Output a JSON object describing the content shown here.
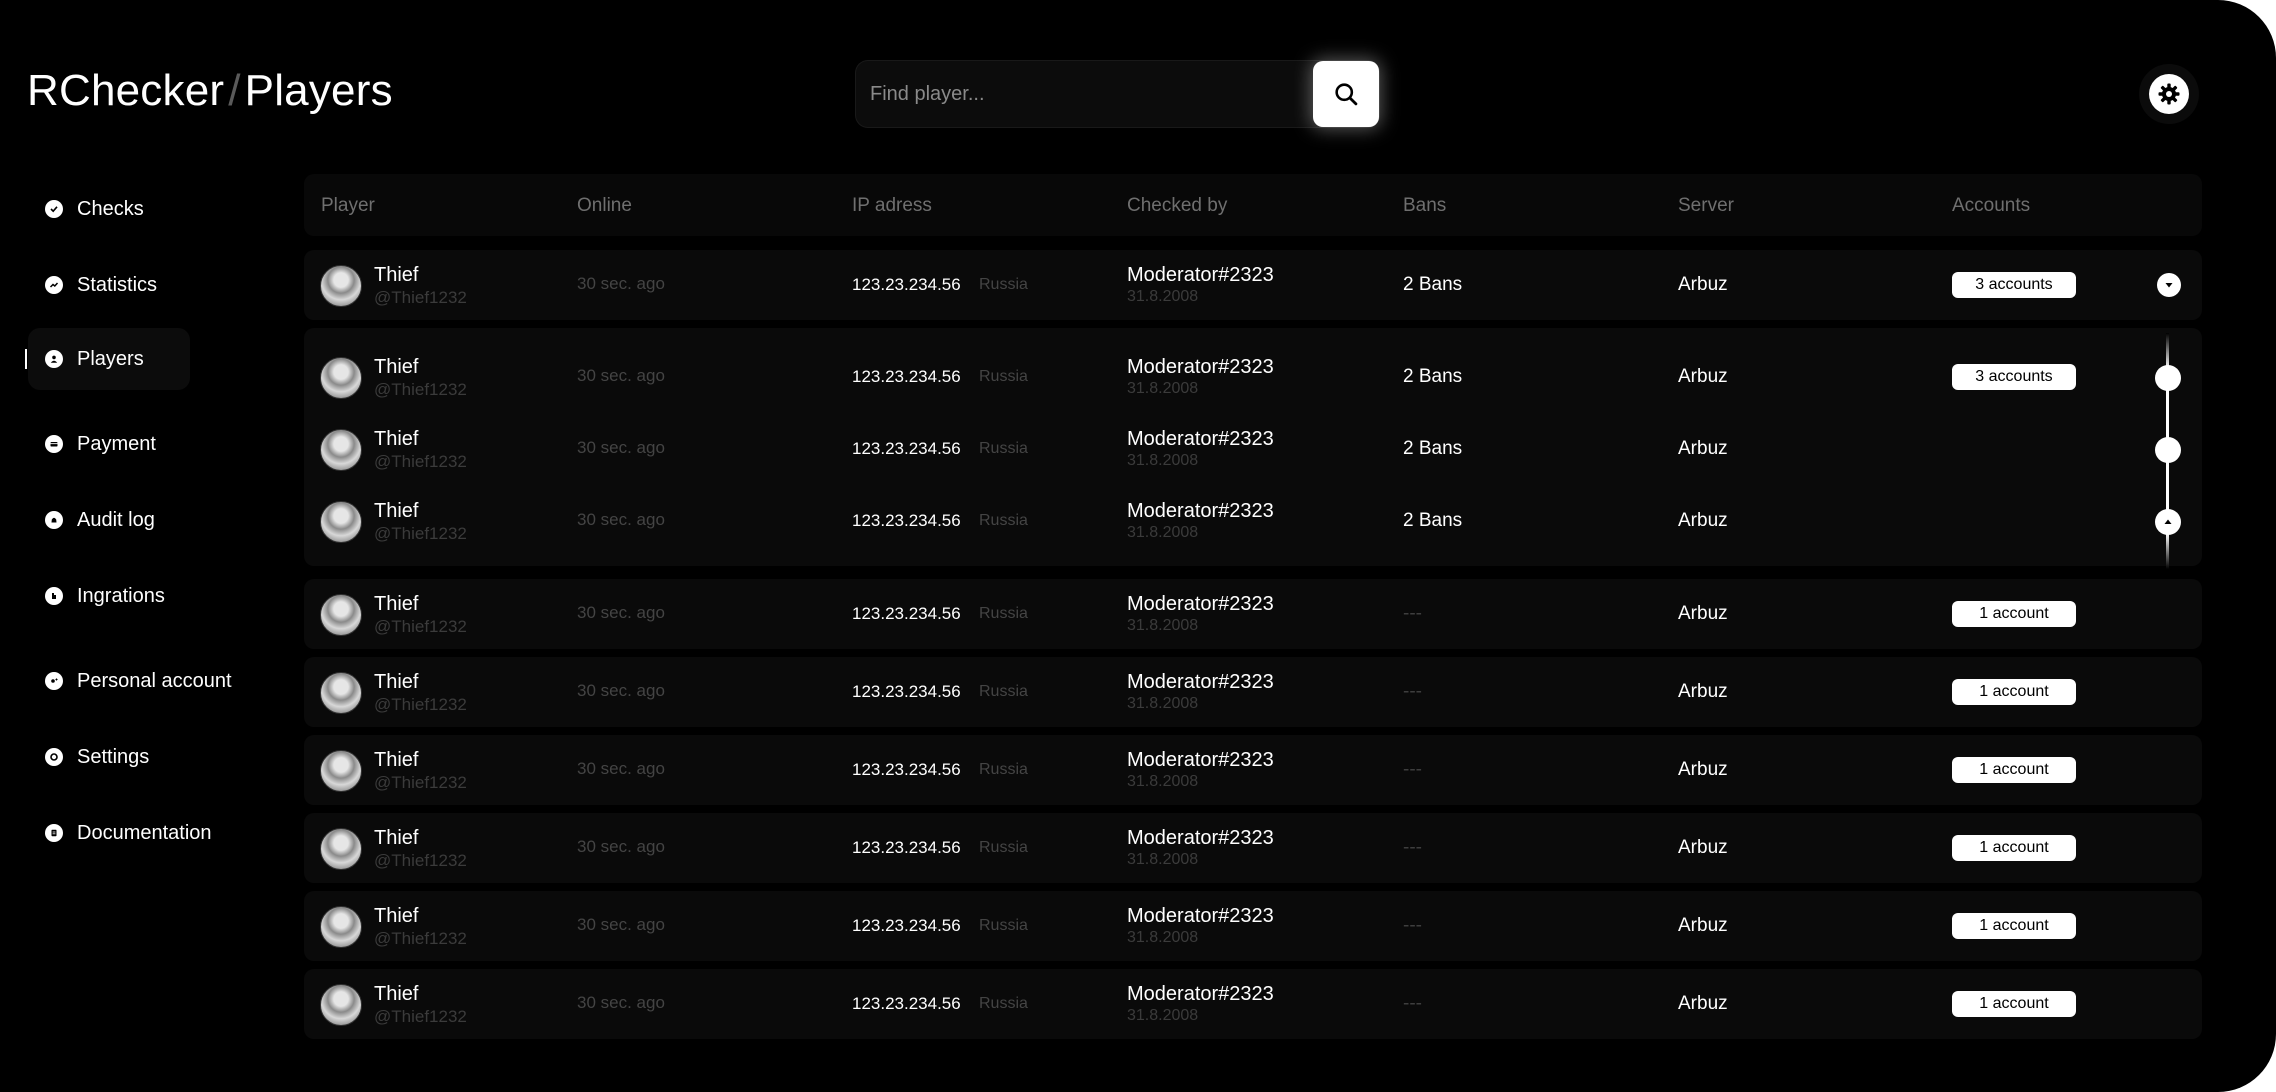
{
  "header": {
    "app_name": "RChecker",
    "separator": "/",
    "page_title": "Players",
    "search_placeholder": "Find player...",
    "search_icon": "search-icon",
    "settings_icon": "gear-icon"
  },
  "sidebar": {
    "items": [
      {
        "label": "Checks",
        "icon": "check-circle-icon"
      },
      {
        "label": "Statistics",
        "icon": "trend-icon"
      },
      {
        "label": "Players",
        "icon": "user-icon",
        "active": true
      },
      {
        "label": "Payment",
        "icon": "card-icon"
      },
      {
        "label": "Audit log",
        "icon": "bell-icon"
      },
      {
        "label": "Ingrations",
        "icon": "puzzle-icon"
      },
      {
        "label": "Personal account",
        "icon": "account-icon"
      },
      {
        "label": "Settings",
        "icon": "gear-icon"
      },
      {
        "label": "Documentation",
        "icon": "doc-icon"
      }
    ]
  },
  "table": {
    "columns": [
      "Player",
      "Online",
      "IP adress",
      "Checked by",
      "Bans",
      "Server",
      "Accounts"
    ],
    "rows": [
      {
        "name": "Thief",
        "handle": "@Thief1232",
        "online": "30 sec. ago",
        "ip": "123.23.234.56",
        "country": "Russia",
        "checked_by": "Moderator#2323",
        "date": "31.8.2008",
        "bans": "2 Bans",
        "server": "Arbuz",
        "accounts": "3 accounts"
      },
      {
        "name": "Thief",
        "handle": "@Thief1232",
        "online": "30 sec. ago",
        "ip": "123.23.234.56",
        "country": "Russia",
        "checked_by": "Moderator#2323",
        "date": "31.8.2008",
        "bans": "2 Bans",
        "server": "Arbuz",
        "accounts": "3 accounts"
      },
      {
        "name": "Thief",
        "handle": "@Thief1232",
        "online": "30 sec. ago",
        "ip": "123.23.234.56",
        "country": "Russia",
        "checked_by": "Moderator#2323",
        "date": "31.8.2008",
        "bans": "2 Bans",
        "server": "Arbuz",
        "accounts": ""
      },
      {
        "name": "Thief",
        "handle": "@Thief1232",
        "online": "30 sec. ago",
        "ip": "123.23.234.56",
        "country": "Russia",
        "checked_by": "Moderator#2323",
        "date": "31.8.2008",
        "bans": "2 Bans",
        "server": "Arbuz",
        "accounts": ""
      },
      {
        "name": "Thief",
        "handle": "@Thief1232",
        "online": "30 sec. ago",
        "ip": "123.23.234.56",
        "country": "Russia",
        "checked_by": "Moderator#2323",
        "date": "31.8.2008",
        "bans": "---",
        "server": "Arbuz",
        "accounts": "1 account"
      },
      {
        "name": "Thief",
        "handle": "@Thief1232",
        "online": "30 sec. ago",
        "ip": "123.23.234.56",
        "country": "Russia",
        "checked_by": "Moderator#2323",
        "date": "31.8.2008",
        "bans": "---",
        "server": "Arbuz",
        "accounts": "1 account"
      },
      {
        "name": "Thief",
        "handle": "@Thief1232",
        "online": "30 sec. ago",
        "ip": "123.23.234.56",
        "country": "Russia",
        "checked_by": "Moderator#2323",
        "date": "31.8.2008",
        "bans": "---",
        "server": "Arbuz",
        "accounts": "1 account"
      },
      {
        "name": "Thief",
        "handle": "@Thief1232",
        "online": "30 sec. ago",
        "ip": "123.23.234.56",
        "country": "Russia",
        "checked_by": "Moderator#2323",
        "date": "31.8.2008",
        "bans": "---",
        "server": "Arbuz",
        "accounts": "1 account"
      },
      {
        "name": "Thief",
        "handle": "@Thief1232",
        "online": "30 sec. ago",
        "ip": "123.23.234.56",
        "country": "Russia",
        "checked_by": "Moderator#2323",
        "date": "31.8.2008",
        "bans": "---",
        "server": "Arbuz",
        "accounts": "1 account"
      },
      {
        "name": "Thief",
        "handle": "@Thief1232",
        "online": "30 sec. ago",
        "ip": "123.23.234.56",
        "country": "Russia",
        "checked_by": "Moderator#2323",
        "date": "31.8.2008",
        "bans": "---",
        "server": "Arbuz",
        "accounts": "1 account"
      }
    ]
  },
  "colors": {
    "background": "#000000",
    "accent": "#ffffff",
    "muted_text": "#6f6f6f"
  }
}
